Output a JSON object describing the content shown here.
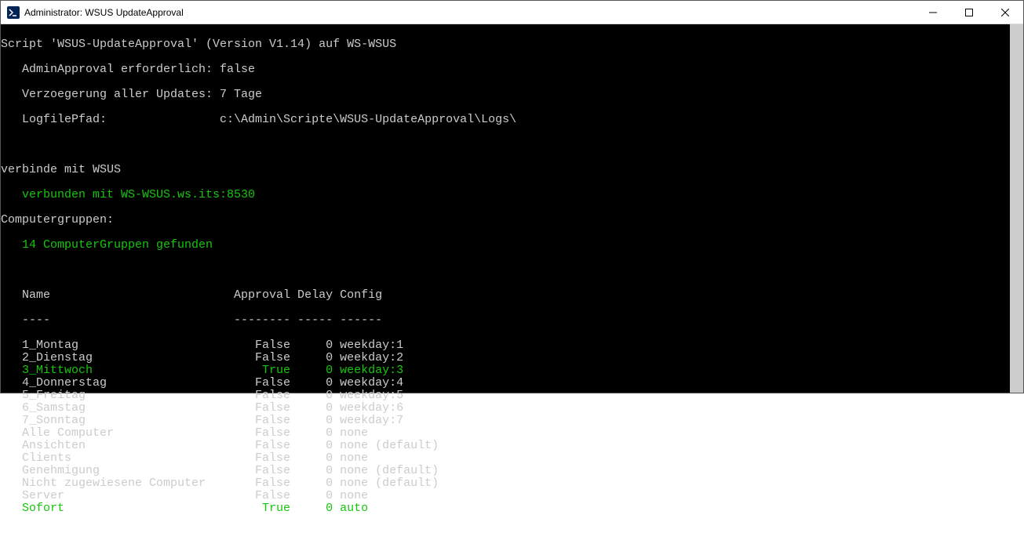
{
  "window": {
    "title": "Administrator: WSUS UpdateApproval"
  },
  "header": {
    "line": "Script 'WSUS-UpdateApproval' (Version V1.14) auf WS-WSUS",
    "admin_approval_label": "   AdminApproval erforderlich: false",
    "delay_label": "   Verzoegerung aller Updates: 7 Tage",
    "logpath_label": "   LogfilePfad:                c:\\Admin\\Scripte\\WSUS-UpdateApproval\\Logs\\"
  },
  "connect": {
    "label": "verbinde mit WSUS",
    "status": "   verbunden mit WS-WSUS.ws.its:8530"
  },
  "groups": {
    "label": "Computergruppen:",
    "found": "   14 ComputerGruppen gefunden"
  },
  "table": {
    "head": "   Name                          Approval Delay Config",
    "sep": "   ----                          -------- ----- ------",
    "rows": [
      {
        "name": "1_Montag",
        "approval": "False",
        "delay": "0",
        "config": "weekday:1",
        "hl": false
      },
      {
        "name": "2_Dienstag",
        "approval": "False",
        "delay": "0",
        "config": "weekday:2",
        "hl": false
      },
      {
        "name": "3_Mittwoch",
        "approval": "True",
        "delay": "0",
        "config": "weekday:3",
        "hl": true
      },
      {
        "name": "4_Donnerstag",
        "approval": "False",
        "delay": "0",
        "config": "weekday:4",
        "hl": false
      },
      {
        "name": "5_Freitag",
        "approval": "False",
        "delay": "0",
        "config": "weekday:5",
        "hl": false
      },
      {
        "name": "6_Samstag",
        "approval": "False",
        "delay": "0",
        "config": "weekday:6",
        "hl": false
      },
      {
        "name": "7_Sonntag",
        "approval": "False",
        "delay": "0",
        "config": "weekday:7",
        "hl": false
      },
      {
        "name": "Alle Computer",
        "approval": "False",
        "delay": "0",
        "config": "none",
        "hl": false
      },
      {
        "name": "Ansichten",
        "approval": "False",
        "delay": "0",
        "config": "none (default)",
        "hl": false
      },
      {
        "name": "Clients",
        "approval": "False",
        "delay": "0",
        "config": "none",
        "hl": false
      },
      {
        "name": "Genehmigung",
        "approval": "False",
        "delay": "0",
        "config": "none (default)",
        "hl": false
      },
      {
        "name": "Nicht zugewiesene Computer",
        "approval": "False",
        "delay": "0",
        "config": "none (default)",
        "hl": false
      },
      {
        "name": "Server",
        "approval": "False",
        "delay": "0",
        "config": "none",
        "hl": false
      },
      {
        "name": "Sofort",
        "approval": "True",
        "delay": "0",
        "config": "auto",
        "hl": true
      }
    ],
    "widths": {
      "name": 30,
      "approval": 8,
      "delay": 5
    }
  }
}
